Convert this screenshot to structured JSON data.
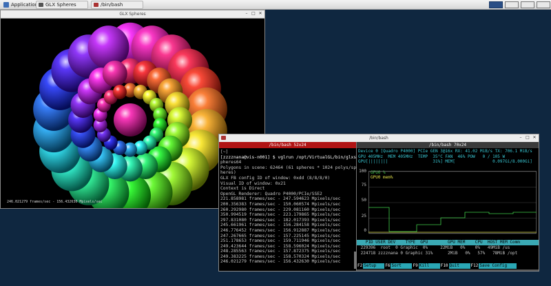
{
  "taskbar": {
    "applications_label": "Applications",
    "tasks": [
      {
        "label": "GLX Spheres"
      },
      {
        "label": "/bin/bash"
      }
    ]
  },
  "glx_window": {
    "title": "GLX Spheres",
    "fps_overlay": "246.021279 frames/sec - 156.432630 Mpixels/sec"
  },
  "terminal_window": {
    "title": "/bin/bash",
    "left_pane": {
      "title": "/bin/bash 52x24",
      "lines": [
        "[~]",
        "[zzzznana@vis-n001] $ vglrun /opt/VirtualGL/bin/glxs",
        "pheres64",
        "Polygons in scene: 62464 (61 spheres * 1024 polys/sp",
        "heres)",
        "GLX FB config ID of window: 0xdd (8/8/8/0)",
        "Visual ID of window: 0x21",
        "Context is Direct",
        "OpenGL Renderer: Quadro P4000/PCIe/SSE2",
        "221.858981 frames/sec - 247.594623 Mpixels/sec",
        "200.356383 frames/sec - 150.060574 Mpixels/sec",
        "260.292980 frames/sec - 229.081160 Mpixels/sec",
        "350.994519 frames/sec - 223.179865 Mpixels/sec",
        "297.831080 frames/sec - 182.017393 Mpixels/sec",
        "245.661961 frames/sec - 156.284158 Mpixels/sec",
        "246.776452 frames/sec - 156.912887 Mpixels/sec",
        "247.267665 frames/sec - 157.225145 Mpixels/sec",
        "251.178653 frames/sec - 159.711946 Mpixels/sec",
        "249.423644 frames/sec - 158.596024 Mpixels/sec",
        "248.285563 frames/sec - 157.872375 Mpixels/sec",
        "249.383225 frames/sec - 158.570324 Mpixels/sec",
        "246.021279 frames/sec - 156.432630 Mpixels/sec"
      ]
    },
    "right_pane": {
      "title": "/bin/bash 70x24",
      "device_line": "Device 0 [Quadro P4000] PCIe GEN 3@16x RX: 41.02 MiB/s TX: 706.1 MiB/s",
      "clock_line": "GPU 405MHz  MEM 405MHz  TEMP  35°C FAN  46% POW   0 / 105 W",
      "util_line": "GPU[||||||||                  31%] MEM[               0.097Gi/8.000Gi]",
      "chart_axis": [
        "100",
        "75",
        "50",
        "25",
        "0"
      ],
      "legend_gpu": "GPU0 %",
      "legend_mem": "GPU0 mem%",
      "proc_header": "   PID USER DEV    TYPE  GPU        GPU MEM    CPU  HOST MEM Comm",
      "procs": [
        " 229396  root  0 Graphic  0%     22MiB   0%    0%   49MiB /us",
        " 224718 zzzznana 0 Graphic 31%      2MiB   0%   57%   78MiB /opt"
      ],
      "fkeys": [
        {
          "key": "F2",
          "label": "Setup"
        },
        {
          "key": "F6",
          "label": "Sort"
        },
        {
          "key": "F9",
          "label": "Kill"
        },
        {
          "key": "F10",
          "label": "Quit"
        },
        {
          "key": "F12",
          "label": "Save Config"
        }
      ]
    }
  },
  "colors": {
    "desktop": "#0f2740",
    "left_pane_title": "#b11414",
    "nvtop_header": "#3aa9b4",
    "gpu_line": "#41d14a",
    "mem_line": "#e0e04a"
  }
}
